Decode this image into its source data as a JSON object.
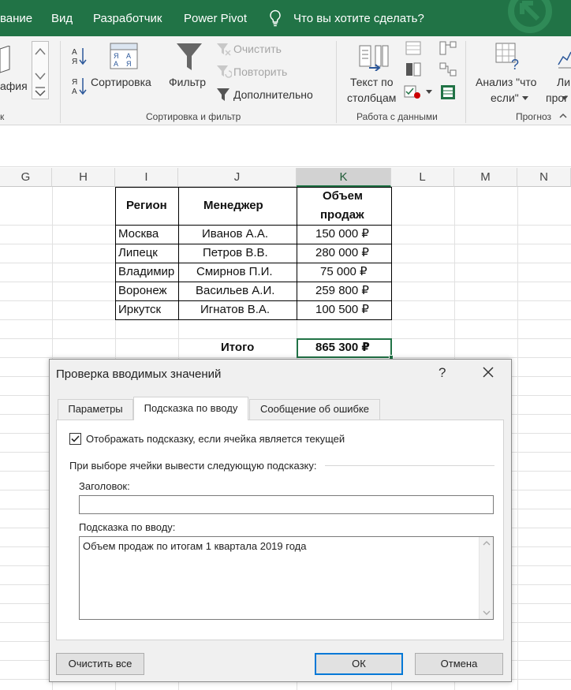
{
  "menubar": {
    "items": [
      "вание",
      "Вид",
      "Разработчик",
      "Power Pivot"
    ],
    "search": "Что вы хотите сделать?",
    "icons": [
      "lightbulb-icon",
      "app-logo-icon"
    ]
  },
  "ribbon": {
    "left_partial": "афия",
    "left_group_partial": "к",
    "sort_label": "Сортировка",
    "filter_label": "Фильтр",
    "clear_label": "Очистить",
    "reapply_label": "Повторить",
    "advanced_label": "Дополнительно",
    "group_sort_filter": "Сортировка и фильтр",
    "text_to_columns_line1": "Текст по",
    "text_to_columns_line2": "столбцам",
    "group_data_tools": "Работа с данными",
    "whatif_line1": "Анализ \"что",
    "whatif_line2": "если\"",
    "forecast_partial_line1": "Ли",
    "forecast_partial_line2": "прог",
    "group_forecast": "Прогноз",
    "colors": {
      "accent": "#217346",
      "filter_icon": "#666666"
    }
  },
  "grid": {
    "columns": [
      "G",
      "H",
      "I",
      "J",
      "K",
      "L",
      "M",
      "N"
    ],
    "selected_column": "K"
  },
  "table": {
    "headers": [
      "Регион",
      "Менеджер",
      "Объем",
      "продаж"
    ],
    "rows": [
      [
        "Москва",
        "Иванов А.А.",
        "150 000 ₽"
      ],
      [
        "Липецк",
        "Петров В.В.",
        "280 000 ₽"
      ],
      [
        "Владимир",
        "Смирнов П.И.",
        "75 000 ₽"
      ],
      [
        "Воронеж",
        "Васильев А.И.",
        "259 800 ₽"
      ],
      [
        "Иркутск",
        "Игнатов В.А.",
        "100 500 ₽"
      ]
    ],
    "total_label": "Итого",
    "total_value": "865 300 ₽"
  },
  "dialog": {
    "title": "Проверка вводимых значений",
    "help": "?",
    "tabs": [
      "Параметры",
      "Подсказка по вводу",
      "Сообщение об ошибке"
    ],
    "active_tab": "Подсказка по вводу",
    "checkbox_label": "Отображать подсказку, если ячейка является текущей",
    "checkbox_checked": true,
    "group_label": "При выборе ячейки вывести следующую подсказку:",
    "title_field_label": "Заголовок:",
    "title_field_value": "",
    "message_label": "Подсказка по вводу:",
    "message_value": "Объем продаж по итогам 1 квартала 2019 года",
    "clear_all": "Очистить все",
    "ok": "ОК",
    "cancel": "Отмена"
  }
}
